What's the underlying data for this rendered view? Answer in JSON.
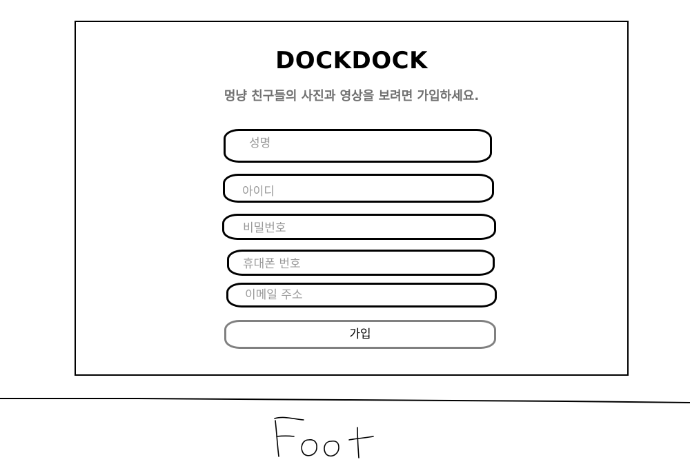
{
  "header": {
    "brand": "DOCKDOCK",
    "tagline": "멍냥 친구들의 사진과 영상을 보려면 가입하세요."
  },
  "form": {
    "name_placeholder": "성명",
    "id_placeholder": "아이디",
    "password_placeholder": "비밀번호",
    "phone_placeholder": "휴대폰 번호",
    "email_placeholder": "이메일 주소",
    "submit_label": "가입"
  },
  "footer": {
    "label": "Foot"
  }
}
